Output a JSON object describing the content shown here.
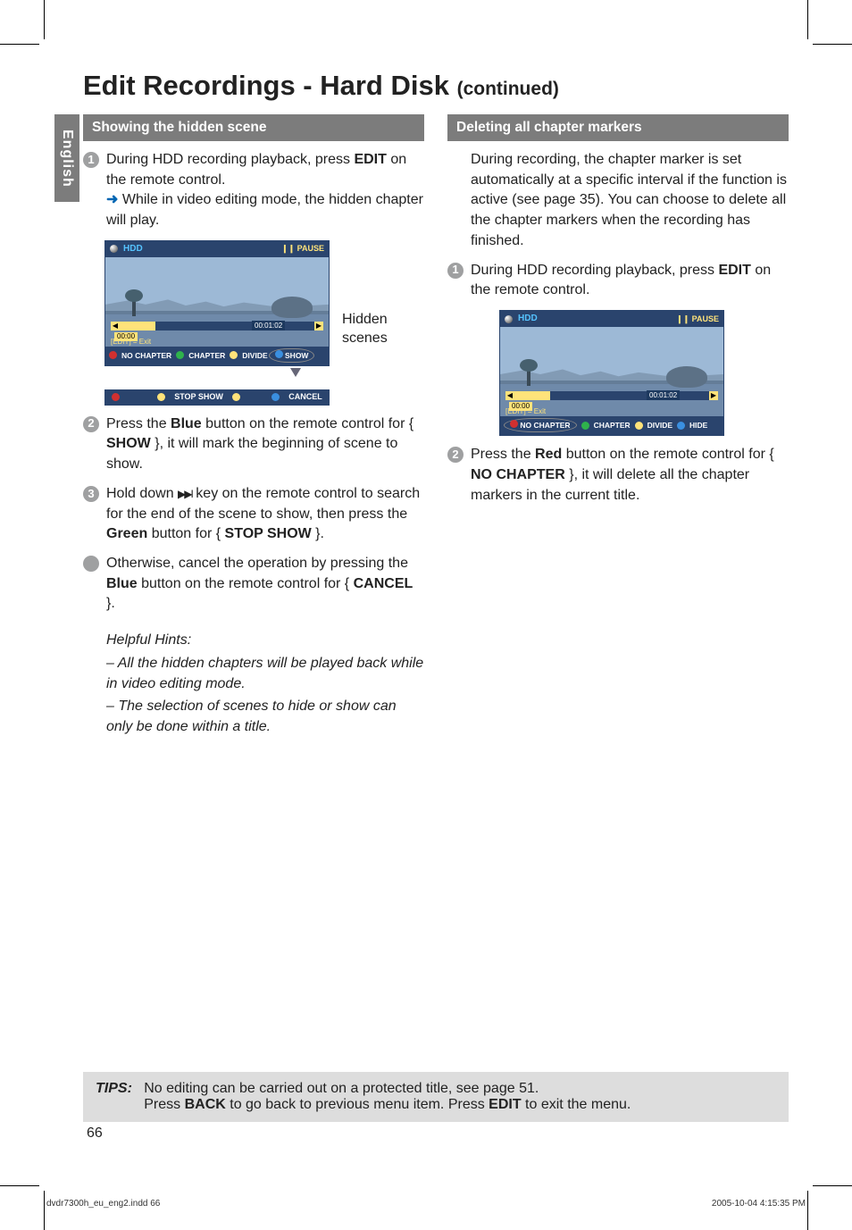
{
  "side_tab": "English",
  "page_title_main": "Edit Recordings - Hard Disk ",
  "page_title_suffix": "(continued)",
  "left": {
    "band": "Showing the hidden scene",
    "step1_a": "During HDD recording playback, press ",
    "step1_b": "EDIT",
    "step1_c": " on the remote control.",
    "step1_arrow": "➜",
    "step1_d": " While in video editing mode, the hidden chapter will play.",
    "side_caption": "Hidden scenes",
    "step2_a": "Press the ",
    "step2_b": "Blue",
    "step2_c": " button on the remote control for { ",
    "step2_d": "SHOW",
    "step2_e": " }, it will mark the beginning of scene to show.",
    "step3_a": "Hold down ",
    "step3_icon": "▶▶I",
    "step3_b": " key on the remote control to search for the end of the scene to show, then press the ",
    "step3_c": "Green",
    "step3_d": " button for { ",
    "step3_e": "STOP SHOW",
    "step3_f": " }.",
    "otherwise_a": "Otherwise, cancel the operation by pressing the ",
    "otherwise_b": "Blue",
    "otherwise_c": " button on the remote control for { ",
    "otherwise_d": "CANCEL",
    "otherwise_e": " }.",
    "hints_title": "Helpful Hints:",
    "hints_1": "–  All the hidden chapters will be played back while in video editing mode.",
    "hints_2": "–  The selection of scenes to hide or show can only be done within a title."
  },
  "right": {
    "band": "Deleting all chapter markers",
    "intro": "During recording, the chapter marker is set automatically at a specific interval if the function is active (see page 35). You can choose to delete all the chapter markers when the recording has finished.",
    "step1_a": "During HDD recording playback, press ",
    "step1_b": "EDIT",
    "step1_c": " on the remote control.",
    "step2_a": "Press the ",
    "step2_b": "Red",
    "step2_c": " button on the remote control for { ",
    "step2_d": "NO CHAPTER",
    "step2_e": " }, it will delete all the chapter markers in the current title."
  },
  "player_left": {
    "hdd": "HDD",
    "pause": "❙❙ PAUSE",
    "timer_left": "00:00",
    "timer_mid": "00:01:02",
    "edit_exit": "[EDIT] = Exit",
    "row_red": "NO CHAPTER",
    "row_green": "CHAPTER",
    "row_yellow": "DIVIDE",
    "row_blue": "SHOW",
    "row2_red": "",
    "row2_yellow": "STOP SHOW",
    "row2_blue": "CANCEL"
  },
  "player_right": {
    "hdd": "HDD",
    "pause": "❙❙ PAUSE",
    "timer_left": "00:00",
    "timer_mid": "00:01:02",
    "edit_exit": "[EDIT] = Exit",
    "row_red": "NO CHAPTER",
    "row_green": "CHAPTER",
    "row_yellow": "DIVIDE",
    "row_blue": "HIDE"
  },
  "tips_label": "TIPS:",
  "tips_line1_a": "No editing can be carried out on a protected title, see page 51.",
  "tips_line2_a": "Press ",
  "tips_line2_b": "BACK",
  "tips_line2_c": " to go back to previous menu item. Press ",
  "tips_line2_d": "EDIT",
  "tips_line2_e": " to exit the menu.",
  "page_number": "66",
  "footer_left": "dvdr7300h_eu_eng2.indd   66",
  "footer_right": "2005-10-04   4:15:35 PM"
}
